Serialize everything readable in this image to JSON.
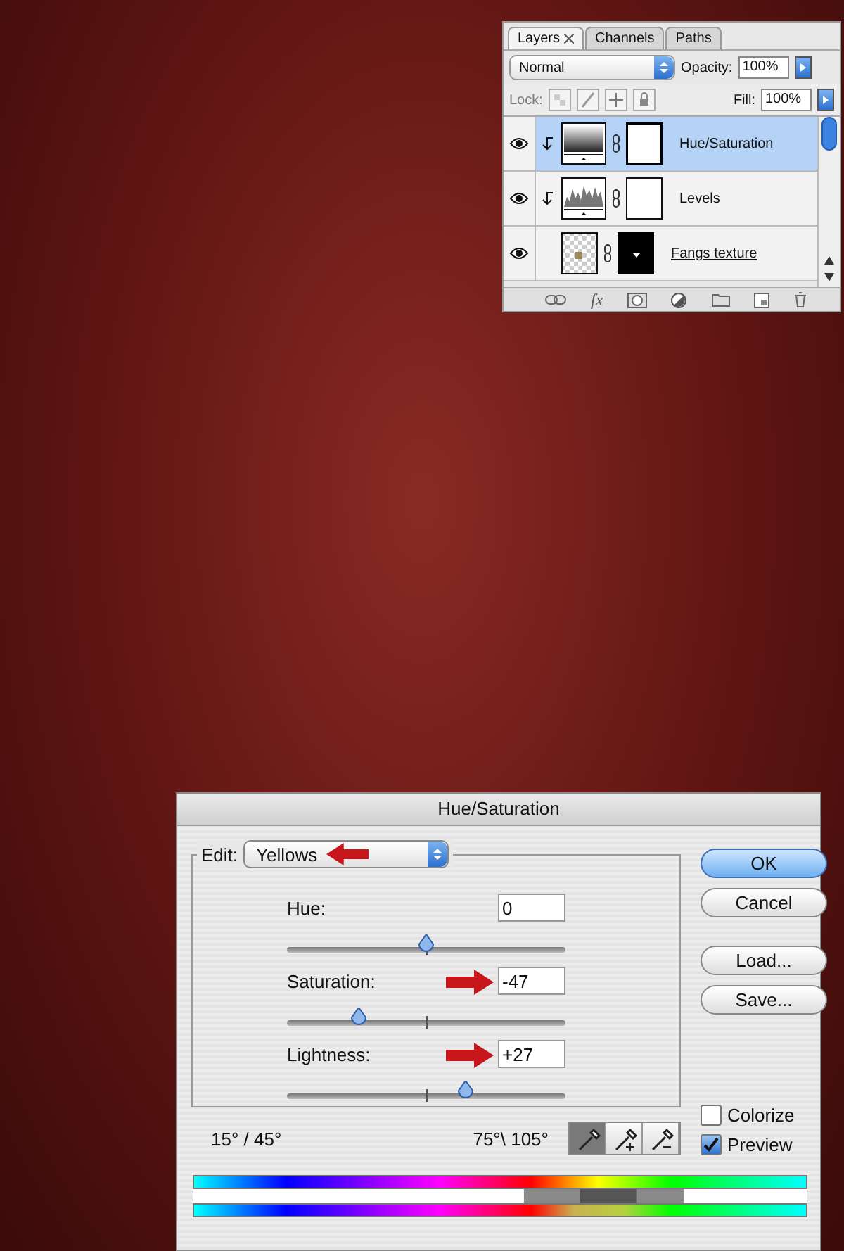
{
  "layers_panel": {
    "tabs": [
      {
        "label": "Layers",
        "selected": true,
        "closable": true
      },
      {
        "label": "Channels",
        "selected": false,
        "closable": false
      },
      {
        "label": "Paths",
        "selected": false,
        "closable": false
      }
    ],
    "blend_mode": "Normal",
    "opacity_label": "Opacity:",
    "opacity": "100%",
    "lock_label": "Lock:",
    "fill_label": "Fill:",
    "fill": "100%",
    "layers": [
      {
        "name": "Hue/Saturation",
        "kind": "hue-saturation",
        "visible": true,
        "clipped": true,
        "selected": true,
        "underlined": false
      },
      {
        "name": "Levels",
        "kind": "levels",
        "visible": true,
        "clipped": true,
        "selected": false,
        "underlined": false
      },
      {
        "name": "Fangs texture",
        "kind": "pixel",
        "visible": true,
        "clipped": false,
        "selected": false,
        "underlined": true
      }
    ],
    "effects_label": "fx"
  },
  "dialog": {
    "title": "Hue/Saturation",
    "edit_label": "Edit:",
    "edit_value": "Yellows",
    "edit_marked": true,
    "sliders": [
      {
        "label": "Hue:",
        "value": "0",
        "level": 0.5,
        "marked": false
      },
      {
        "label": "Saturation:",
        "value": "-47",
        "level": 0.26,
        "marked": true
      },
      {
        "label": "Lightness:",
        "value": "+27",
        "level": 0.64,
        "marked": true
      }
    ],
    "buttons": [
      {
        "label": "OK",
        "default": true
      },
      {
        "label": "Cancel",
        "default": false
      },
      {
        "label": "Load...",
        "default": false
      },
      {
        "label": "Save...",
        "default": false
      }
    ],
    "range_left": "15° / 45°",
    "range_right": "75°\\ 105°",
    "eyedroppers": [
      {
        "kind": "sample",
        "selected": true
      },
      {
        "kind": "add",
        "selected": false
      },
      {
        "kind": "subtract",
        "selected": false
      }
    ],
    "checkboxes": [
      {
        "label": "Colorize",
        "checked": false
      },
      {
        "label": "Preview",
        "checked": true
      }
    ]
  }
}
